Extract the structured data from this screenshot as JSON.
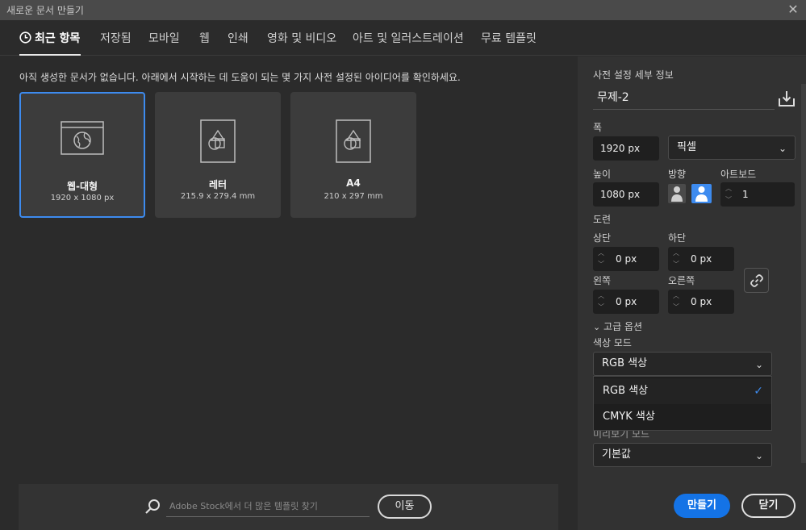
{
  "window": {
    "title": "새로운 문서 만들기",
    "close_icon": "close-icon"
  },
  "tabs": [
    {
      "label": "최근 항목",
      "active": true
    },
    {
      "label": "저장됨"
    },
    {
      "label": "모바일"
    },
    {
      "label": "웹"
    },
    {
      "label": "인쇄"
    },
    {
      "label": "영화 및 비디오"
    },
    {
      "label": "아트 및 일러스트레이션"
    },
    {
      "label": "무료 템플릿"
    }
  ],
  "main": {
    "hint": "아직 생성한 문서가 없습니다. 아래에서 시작하는 데 도움이 되는 몇 가지 사전 설정된 아이디어를 확인하세요.",
    "presets": [
      {
        "name": "웹-대형",
        "size": "1920 x 1080 px",
        "icon": "web-document-icon",
        "selected": true
      },
      {
        "name": "레터",
        "size": "215.9 x 279.4 mm",
        "icon": "print-document-icon"
      },
      {
        "name": "A4",
        "size": "210 x 297 mm",
        "icon": "print-document-icon"
      }
    ],
    "stock": {
      "placeholder": "Adobe Stock에서 더 많은 템플릿 찾기",
      "go_label": "이동"
    }
  },
  "details": {
    "heading": "사전 설정 세부 정보",
    "name": "무제-2",
    "width_label": "폭",
    "width_value": "1920 px",
    "unit": "픽셀",
    "height_label": "높이",
    "height_value": "1080 px",
    "orientation_label": "방향",
    "artboard_label": "아트보드",
    "artboard_value": "1",
    "bleed_label": "도련",
    "top_label": "상단",
    "top_value": "0 px",
    "bottom_label": "하단",
    "bottom_value": "0 px",
    "left_label": "왼쪽",
    "left_value": "0 px",
    "right_label": "오른쪽",
    "right_value": "0 px",
    "advanced_label": "고급 옵션",
    "color_mode_label": "색상 모드",
    "color_mode_value": "RGB 색상",
    "color_options": [
      "RGB 색상",
      "CMYK 색상"
    ],
    "preview_mode_label": "미리보기 모드",
    "preview_mode_value": "기본값",
    "create_label": "만들기",
    "close_label": "닫기"
  },
  "colors": {
    "accent": "#1473e6",
    "selection_border": "#3d8bef",
    "background": "#2b2b2b",
    "panel": "#323232"
  }
}
